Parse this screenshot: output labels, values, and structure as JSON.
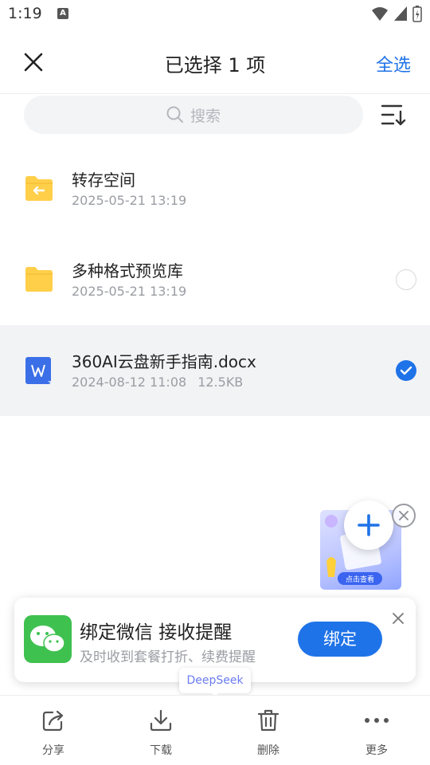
{
  "status_bar": {
    "time": "1:19",
    "notification_badge": "A"
  },
  "header": {
    "title": "已选择 1 项",
    "select_all": "全选"
  },
  "search": {
    "placeholder": "搜索"
  },
  "files": [
    {
      "name": "转存空间",
      "date": "2025-05-21 13:19",
      "size": "",
      "icon": "folder-transfer-icon",
      "selected": false,
      "show_radio": false
    },
    {
      "name": "多种格式预览库",
      "date": "2025-05-21 13:19",
      "size": "",
      "icon": "folder-icon",
      "selected": false,
      "show_radio": true
    },
    {
      "name": "360AI云盘新手指南.docx",
      "date": "2024-08-12 11:08",
      "size": "12.5KB",
      "icon": "docx-file-icon",
      "selected": true,
      "show_radio": true
    }
  ],
  "promo": {
    "badge_text": "点击查看"
  },
  "wechat_banner": {
    "title": "绑定微信 接收提醒",
    "subtitle": "及时收到套餐打折、续费提醒",
    "bind_button": "绑定"
  },
  "deepseek_tag": "DeepSeek",
  "bottom_bar": [
    {
      "label": "分享",
      "icon": "share-icon"
    },
    {
      "label": "下载",
      "icon": "download-icon"
    },
    {
      "label": "删除",
      "icon": "trash-icon"
    },
    {
      "label": "更多",
      "icon": "more-icon"
    }
  ],
  "colors": {
    "accent": "#1f73e8",
    "folder": "#ffcf4a",
    "wechat": "#3fc150",
    "selected_row": "#f2f3f5"
  }
}
